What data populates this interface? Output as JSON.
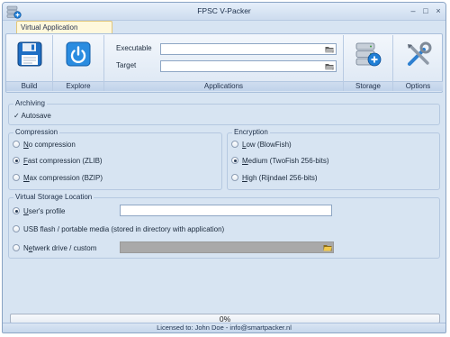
{
  "window": {
    "title": "FPSC V-Packer",
    "controls": [
      "minimize",
      "maximize",
      "close"
    ]
  },
  "ribbon": {
    "tab_label": "Virtual Application",
    "build_label": "Build",
    "explore_label": "Explore",
    "applications_label": "Applications",
    "storage_label": "Storage",
    "options_label": "Options",
    "executable_label": "Executable",
    "target_label": "Target",
    "executable_value": "",
    "target_value": ""
  },
  "archiving": {
    "title": "Archiving",
    "autosave_label": "Autosave",
    "autosave_checked": true
  },
  "compression": {
    "title": "Compression",
    "options": [
      {
        "pre": "",
        "key": "N",
        "rest": "o compression",
        "selected": false
      },
      {
        "pre": "",
        "key": "F",
        "rest": "ast compression (ZLIB)",
        "selected": true
      },
      {
        "pre": "",
        "key": "M",
        "rest": "ax compression (BZIP)",
        "selected": false
      }
    ]
  },
  "encryption": {
    "title": "Encryption",
    "options": [
      {
        "pre": "",
        "key": "L",
        "rest": "ow (BlowFish)",
        "selected": false
      },
      {
        "pre": "",
        "key": "M",
        "rest": "edium (TwoFish 256-bits)",
        "selected": true
      },
      {
        "pre": "",
        "key": "H",
        "rest": "igh (Rijndael 256-bits)",
        "selected": false
      }
    ]
  },
  "storage_location": {
    "title": "Virtual Storage Location",
    "users_profile": {
      "pre": "",
      "key": "U",
      "rest": "ser's profile",
      "selected": true
    },
    "usb": {
      "pre": "USB flash / portable media (stored in directory with application)",
      "key": "",
      "rest": "",
      "selected": false
    },
    "network": {
      "pre": "N",
      "key": "e",
      "rest": "twerk drive / custom",
      "selected": false
    },
    "profile_value": "",
    "network_value": ""
  },
  "progress": {
    "value": 0,
    "text": "0%"
  },
  "status": {
    "text": "Licensed to: John Doe - info@smartpacker.nl"
  },
  "colors": {
    "accent": "#1f7fd6",
    "frame": "#d7e4f2"
  }
}
